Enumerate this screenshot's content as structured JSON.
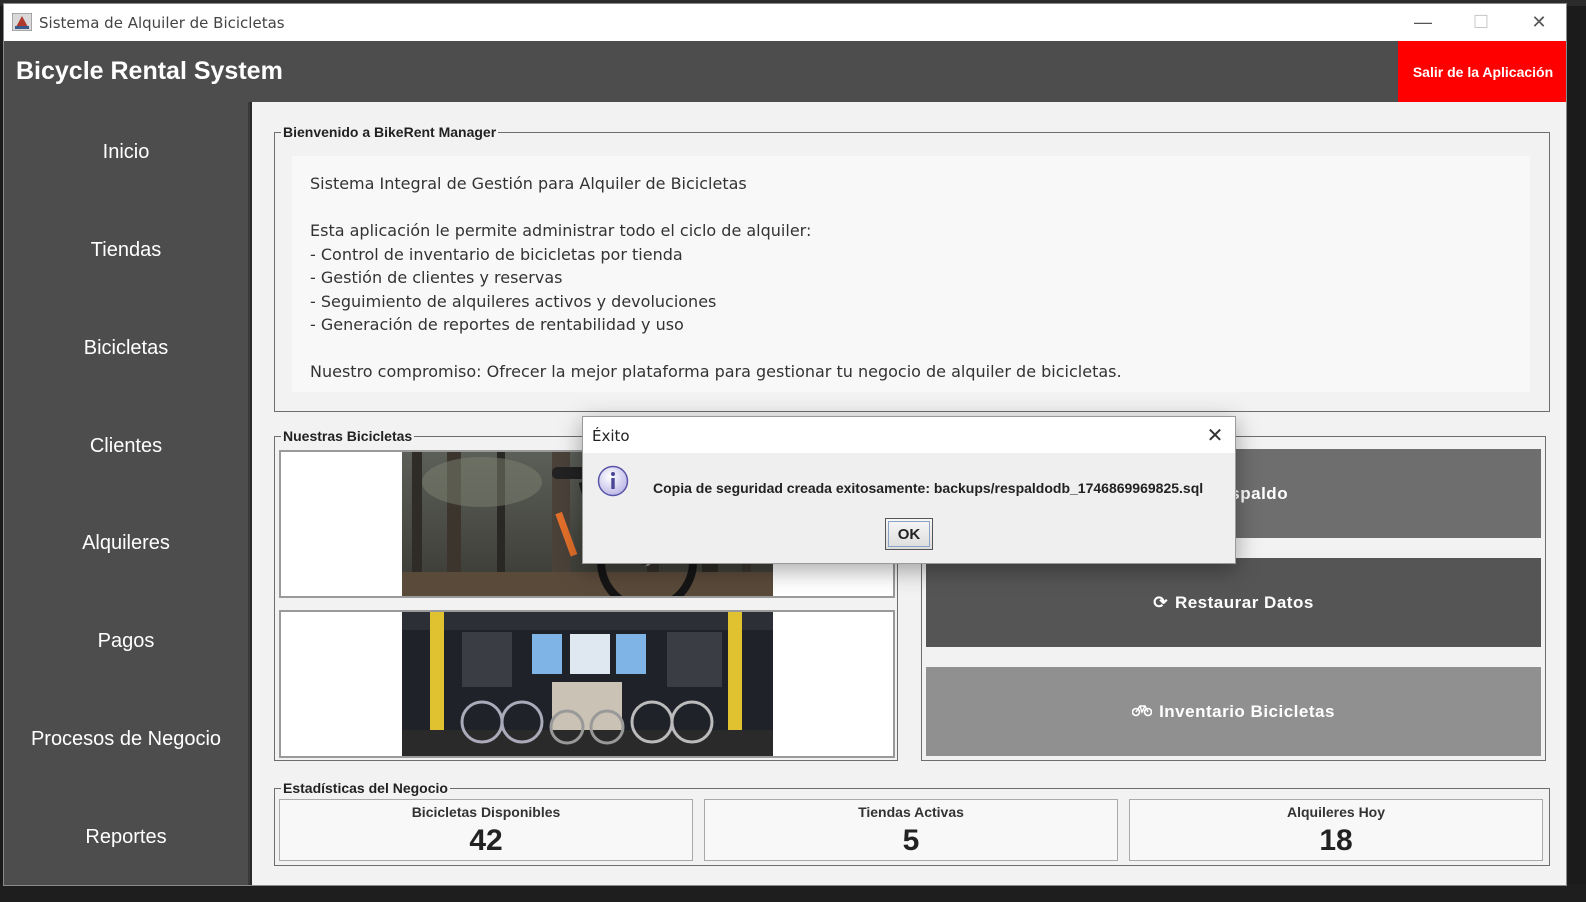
{
  "window": {
    "title": "Sistema de Alquiler de Bicicletas",
    "minimize_glyph": "—",
    "maximize_glyph": "☐",
    "close_glyph": "✕"
  },
  "header": {
    "title": "Bicycle Rental System",
    "exit_label": "Salir de la Aplicación"
  },
  "sidebar": {
    "items": [
      {
        "label": "Inicio"
      },
      {
        "label": "Tiendas"
      },
      {
        "label": "Bicicletas"
      },
      {
        "label": "Clientes"
      },
      {
        "label": "Alquileres"
      },
      {
        "label": "Pagos"
      },
      {
        "label": "Procesos de Negocio"
      },
      {
        "label": "Reportes"
      }
    ]
  },
  "welcome": {
    "legend": "Bienvenido a BikeRent Manager",
    "lines": [
      "Sistema Integral de Gestión para Alquiler de Bicicletas",
      "Esta aplicación le permite administrar todo el ciclo de alquiler:",
      "- Control de inventario de bicicletas por tienda",
      "- Gestión de clientes y reservas",
      "- Seguimiento de alquileres activos y devoluciones",
      "- Generación de reportes de rentabilidad y uso",
      "Nuestro compromiso: Ofrecer la mejor plataforma para gestionar tu negocio de alquiler de bicicletas."
    ]
  },
  "bikes": {
    "legend": "Nuestras Bicicletas"
  },
  "actions": {
    "items": [
      {
        "label": "Respaldo",
        "icon": "save-icon",
        "color": "#6e6e6e"
      },
      {
        "label": "Restaurar Datos",
        "icon": "refresh-icon",
        "color": "#555555"
      },
      {
        "label": "Inventario Bicicletas",
        "icon": "bicycle-icon",
        "color": "#909090"
      }
    ]
  },
  "stats": {
    "legend": "Estadísticas del Negocio",
    "cards": [
      {
        "label": "Bicicletas Disponibles",
        "value": "42"
      },
      {
        "label": "Tiendas Activas",
        "value": "5"
      },
      {
        "label": "Alquileres Hoy",
        "value": "18"
      }
    ]
  },
  "dialog": {
    "title": "Éxito",
    "message": "Copia de seguridad creada exitosamente: backups/respaldodb_1746869969825.sql",
    "ok_label": "OK",
    "close_glyph": "✕"
  },
  "colors": {
    "header_bg": "#4d4d4d",
    "exit_bg": "#ff0000",
    "main_bg": "#f2f2f2"
  }
}
